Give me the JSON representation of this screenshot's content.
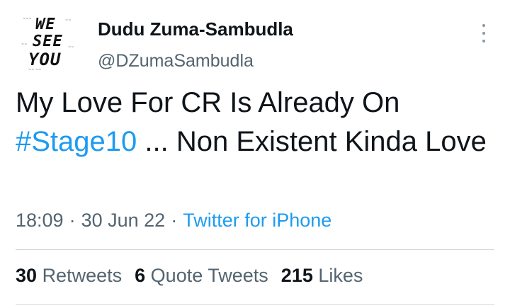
{
  "author": {
    "display_name": "Dudu Zuma-Sambudla",
    "handle": "@DZumaSambudla",
    "avatar_text": [
      "WE",
      "SEE",
      "YOU"
    ]
  },
  "tweet": {
    "text_before": "My Love For CR Is Already On ",
    "hashtag": "#Stage10",
    "text_after": " ... Non Existent Kinda Love"
  },
  "meta": {
    "time": "18:09",
    "separator": "·",
    "date": "30 Jun 22",
    "source": "Twitter for iPhone"
  },
  "stats": {
    "retweets_count": "30",
    "retweets_label": "Retweets",
    "quotes_count": "6",
    "quotes_label": "Quote Tweets",
    "likes_count": "215",
    "likes_label": "Likes"
  },
  "colors": {
    "link": "#1d9bf0",
    "secondary_text": "#536471",
    "primary_text": "#0f1419"
  },
  "icons": {
    "more": "more-vertical-icon"
  }
}
